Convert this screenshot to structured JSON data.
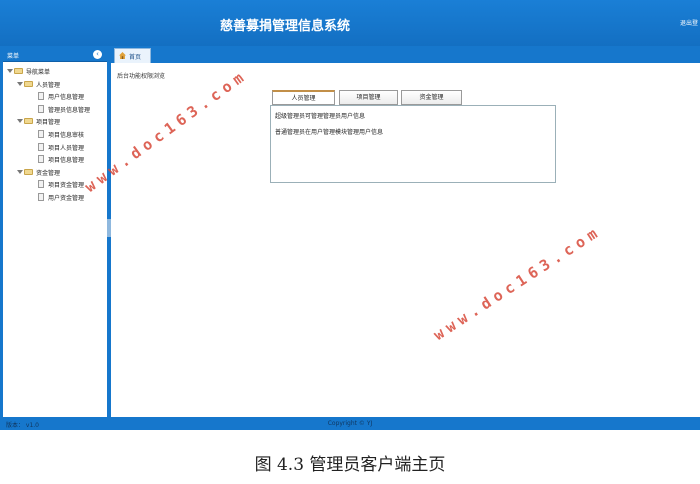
{
  "header": {
    "title": "慈善募捐管理信息系统",
    "logout_label": "退出登"
  },
  "sidebar": {
    "title": "菜单",
    "collapse_icon": "chevron-left-icon",
    "tree": [
      {
        "label": "导航菜单",
        "type": "folder",
        "level": 0
      },
      {
        "label": "人员管理",
        "type": "folder",
        "level": 1
      },
      {
        "label": "用户信息管理",
        "type": "file",
        "level": 2
      },
      {
        "label": "管理员信息管理",
        "type": "file",
        "level": 2
      },
      {
        "label": "项目管理",
        "type": "folder",
        "level": 1
      },
      {
        "label": "项目信息审核",
        "type": "file",
        "level": 2
      },
      {
        "label": "项目人员管理",
        "type": "file",
        "level": 2
      },
      {
        "label": "项目信息管理",
        "type": "file",
        "level": 2
      },
      {
        "label": "资金管理",
        "type": "folder",
        "level": 1
      },
      {
        "label": "项目资金管理",
        "type": "file",
        "level": 2
      },
      {
        "label": "用户资金管理",
        "type": "file",
        "level": 2
      }
    ]
  },
  "main": {
    "home_tab": "首页",
    "description": "后台功能权限浏览",
    "tabs": [
      "人员管理",
      "项目管理",
      "资金管理"
    ],
    "active_tab": "人员管理",
    "content": {
      "line1": "超级管理员可管理管理员用户信息",
      "line2": "普通管理员在用户管理模块管理用户信息"
    }
  },
  "footer": {
    "version": "版本： v1.0",
    "copyright": "Copyright © YJ"
  },
  "watermark": "www.doc163.com",
  "caption": "图 4.3 管理员客户端主页",
  "colors": {
    "primary": "#1677cc",
    "tab_accent": "#c28f48",
    "watermark": "#d84a3a"
  }
}
